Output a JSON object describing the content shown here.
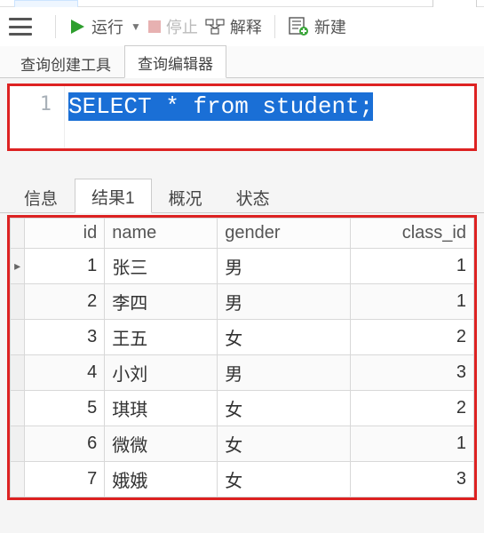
{
  "toolbar": {
    "run_label": "运行",
    "stop_label": "停止",
    "explain_label": "解释",
    "new_label": "新建"
  },
  "upper_tabs": {
    "builder": "查询创建工具",
    "editor": "查询编辑器"
  },
  "editor": {
    "line_number": "1",
    "sql": "SELECT * from student;"
  },
  "result_tabs": {
    "info": "信息",
    "result1": "结果1",
    "profile": "概况",
    "status": "状态"
  },
  "table": {
    "headers": {
      "id": "id",
      "name": "name",
      "gender": "gender",
      "class_id": "class_id"
    },
    "rows": [
      {
        "id": "1",
        "name": "张三",
        "gender": "男",
        "class_id": "1"
      },
      {
        "id": "2",
        "name": "李四",
        "gender": "男",
        "class_id": "1"
      },
      {
        "id": "3",
        "name": "王五",
        "gender": "女",
        "class_id": "2"
      },
      {
        "id": "4",
        "name": "小刘",
        "gender": "男",
        "class_id": "3"
      },
      {
        "id": "5",
        "name": "琪琪",
        "gender": "女",
        "class_id": "2"
      },
      {
        "id": "6",
        "name": "微微",
        "gender": "女",
        "class_id": "1"
      },
      {
        "id": "7",
        "name": "娥娥",
        "gender": "女",
        "class_id": "3"
      }
    ]
  }
}
